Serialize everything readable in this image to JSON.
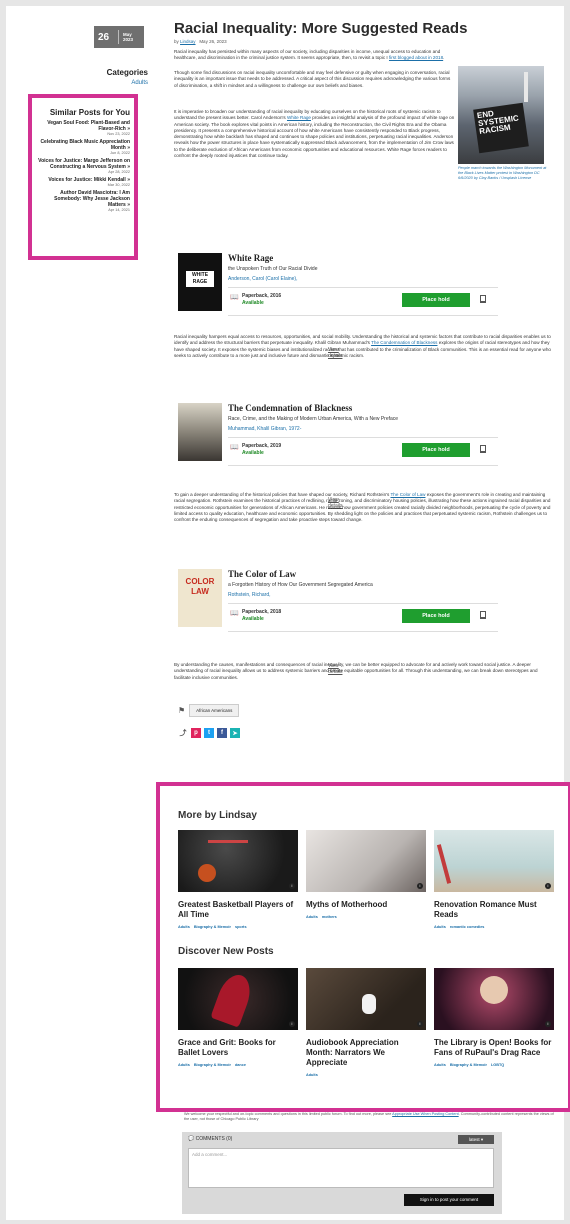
{
  "date": {
    "day": "26",
    "month": "May",
    "year": "2023"
  },
  "categories": {
    "title": "Categories",
    "link": "Adults"
  },
  "similar": {
    "title": "Similar Posts for You",
    "items": [
      {
        "title": "Vegan Soul Food: Plant-Based and Flavor-Rich",
        "date": "Nov 23, 2022"
      },
      {
        "title": "Celebrating Black Music Appreciation Month",
        "date": "Jun 8, 2022"
      },
      {
        "title": "Voices for Justice: Margo Jefferson on Constructing a Nervous System",
        "date": "Apr 28, 2022"
      },
      {
        "title": "Voices for Justice: Mikki Kendall",
        "date": "Mar 30, 2022"
      },
      {
        "title": "Author David Masciotra: I Am Somebody: Why Jesse Jackson Matters",
        "date": "Apr 14, 2021"
      }
    ]
  },
  "post": {
    "title": "Racial Inequality: More Suggested Reads",
    "by": "by",
    "author": "Lindsay",
    "date": "May 26, 2023",
    "p1a": "Racial inequality has persisted within many aspects of our society, including disparities in income, unequal access to education and healthcare, and discrimination in the criminal justice system. It seems appropriate, then, to revisit a topic I ",
    "p1link": "first blogged about in 2018",
    "p2": "Though some find discussions on racial inequality uncomfortable and may feel defensive or guilty when engaging in conversation, racial inequality is an important issue that needs to be addressed. A critical aspect of this discussion requires acknowledging the various forms of discrimination, a shift in mindset and a willingness to challenge our own beliefs and biases.",
    "p3a": "It is imperative to broaden our understanding of racial inequality by educating ourselves on the historical roots of systemic racism to understand the present issues better. Carol Anderson's ",
    "p3link": "White Rage",
    "p3b": " provides an insightful analysis of the profound impact of white rage on American society. The book explores vital points in American history, including the Reconstruction, the Civil Rights Era and the Obama presidency. It presents a comprehensive historical account of how white Americans have consistently responded to Black progress, demonstrating how white backlash has shaped and continues to shape policies and institutions, perpetuating racial inequalities. Anderson reveals how the power structures in place have systematically suppressed Black advancement, from the implementation of Jim Crow laws to the deliberate exclusion of African Americans from economic opportunities and educational resources. White Rage forces readers to confront the deeply rooted injustices that continue today.",
    "caption": "People march towards the Washington Monument at the Black Lives Matter protest in Washington DC 6/6/2020 by Clay Banks / Unsplash License",
    "photo_text": "END SYSTEMIC RACISM",
    "p4a": "Racial inequality hampers equal access to resources, opportunities, and social mobility. Understanding the historical and systemic factors that contribute to racial disparities enables us to identify and address the structural barriers that perpetuate inequality. Khalil Gibran Muhammad's ",
    "p4link": "The Condemnation of Blackness",
    "p4b": " explores the origins of racial stereotypes and how they have shaped society. It exposes the systemic biases and institutionalized racism that has contributed to the criminalization of Black communities. This is an essential read for anyone who seeks to actively contribute to a more just and inclusive future and dismantle systemic racism.",
    "p5a": "To gain a deeper understanding of the historical policies that have shaped our society, Richard Rothstein's ",
    "p5link": "The Color of Law",
    "p5b": " exposes the government's role in creating and maintaining racial segregation. Rothstein examines the historical practices of redlining, racial zoning, and discriminatory housing policies, illustrating how these actions ingrained racial disparities and restricted economic opportunities for generations of African Americans. He reveals how government policies created racially divided neighborhoods, perpetuating the cycle of poverty and limited access to quality education, healthcare and economic opportunities. By shedding light on the policies and practices that perpetuated systemic racism, Rothstein challenges us to confront the enduring consequences of segregation and take proactive steps toward change.",
    "p6": "By understanding the causes, manifestations and consequences of racial inequality, we can be better equipped to advocate for and actively work toward social justice. A deeper understanding of racial inequality allows us to address systemic barriers and create equitable opportunities for all. Through this understanding, we can break down stereotypes and facilitate inclusive communities.",
    "tag": "African Americans"
  },
  "books": [
    {
      "title": "White Rage",
      "subtitle": "the Unspoken Truth of Our Racial Divide",
      "author": "Anderson, Carol (Carol Elaine),",
      "format": "Paperback, 2016",
      "avail": "Available",
      "view": "View details",
      "hold": "Place hold",
      "cover_text": "WHITE RAGE"
    },
    {
      "title": "The Condemnation of Blackness",
      "subtitle": "Race, Crime, and the Making of Modern Urban America, With a New Preface",
      "author": "Muhammad, Khalil Gibran, 1972-",
      "format": "Paperback, 2019",
      "avail": "Available",
      "view": "View details",
      "hold": "Place hold"
    },
    {
      "title": "The Color of Law",
      "subtitle": "a Forgotten History of How Our Government Segregated America",
      "author": "Rothstein, Richard,",
      "format": "Paperback, 2018",
      "avail": "Available",
      "view": "View details",
      "hold": "Place hold",
      "cover_text": "COLOR LAW"
    }
  ],
  "more": {
    "title": "More by Lindsay",
    "cards": [
      {
        "title": "Greatest Basketball Players of All Time",
        "tags": [
          "Adults",
          "Biography & Memoir",
          "sports"
        ]
      },
      {
        "title": "Myths of Motherhood",
        "tags": [
          "Adults",
          "mothers"
        ]
      },
      {
        "title": "Renovation Romance Must Reads",
        "tags": [
          "Adults",
          "romantic comedies"
        ]
      }
    ]
  },
  "discover": {
    "title": "Discover New Posts",
    "cards": [
      {
        "title": "Grace and Grit: Books for Ballet Lovers",
        "tags": [
          "Adults",
          "Biography & Memoir",
          "dance"
        ]
      },
      {
        "title": "Audiobook Appreciation Month: Narrators We Appreciate",
        "tags": [
          "Adults"
        ]
      },
      {
        "title": "The Library is Open! Books for Fans of RuPaul's Drag Race",
        "tags": [
          "Adults",
          "Biography & Memoir",
          "LGBTQ"
        ]
      }
    ]
  },
  "comments": {
    "note_a": "We welcome your respectful and on-topic comments and questions in this limited public forum. To find out more, please see ",
    "note_link": "Appropriate Use When Posting Content",
    "note_b": ". Community-contributed content represents the views of the user, not those of Chicago Public Library",
    "count": "COMMENTS (0)",
    "sort": "latest",
    "placeholder": "Add a comment...",
    "signin": "Sign in to post your comment"
  },
  "colors": {
    "accent": "#d23192",
    "link": "#1b6fa8",
    "hold": "#1f9e2f"
  }
}
